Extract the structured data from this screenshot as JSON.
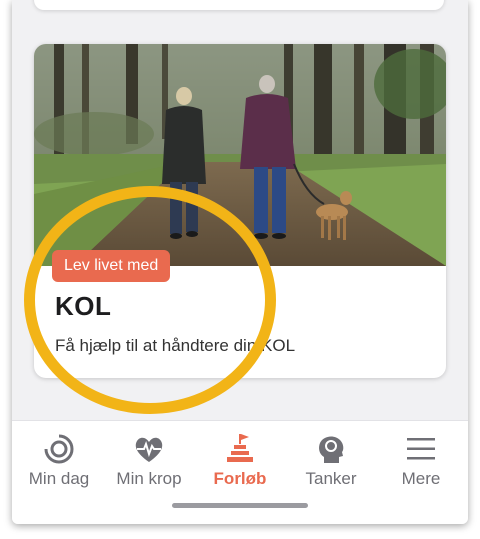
{
  "course_card": {
    "badge": "Lev livet med",
    "title": "KOL",
    "subtitle": "Få hjælp til at håndtere din KOL",
    "image": "photo of elderly couple walking a dog on a forest path",
    "badge_color": "#e96a4f"
  },
  "highlight_color": "#f2b417",
  "nav": {
    "items": [
      {
        "label": "Min dag",
        "icon": "circle-progress-icon",
        "active": false
      },
      {
        "label": "Min krop",
        "icon": "heart-pulse-icon",
        "active": false
      },
      {
        "label": "Forløb",
        "icon": "summit-flag-icon",
        "active": true
      },
      {
        "label": "Tanker",
        "icon": "head-brain-icon",
        "active": false
      },
      {
        "label": "Mere",
        "icon": "menu-icon",
        "active": false
      }
    ],
    "active_color": "#e96a4f",
    "inactive_color": "#6f6f75"
  }
}
